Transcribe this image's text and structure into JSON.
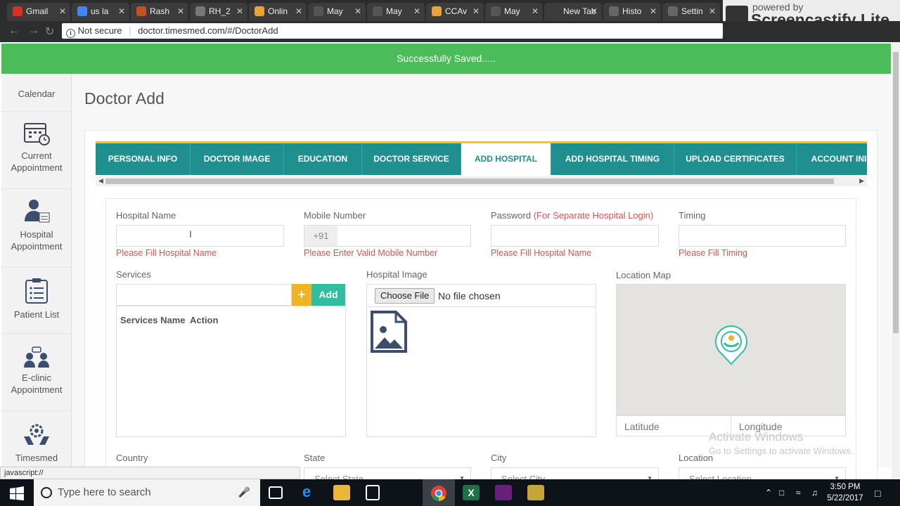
{
  "browser": {
    "tabs": [
      {
        "label": "Gmail",
        "icon_color": "#d93025"
      },
      {
        "label": "us la",
        "icon_color": "#4285f4"
      },
      {
        "label": "Rash",
        "icon_color": "#c8501e"
      },
      {
        "label": "RH_2",
        "icon_color": "#777777"
      },
      {
        "label": "Onlin",
        "icon_color": "#e8a33b"
      },
      {
        "label": "May",
        "icon_color": "#555555"
      },
      {
        "label": "May",
        "icon_color": "#555555"
      },
      {
        "label": "CCAv",
        "icon_color": "#e8a33b"
      },
      {
        "label": "May",
        "icon_color": "#555555"
      },
      {
        "label": "New Tab",
        "icon_color": "#3c3c3c"
      },
      {
        "label": "Histo",
        "icon_color": "#666666"
      },
      {
        "label": "Settin",
        "icon_color": "#666666"
      }
    ],
    "security_label": "Not secure",
    "url": "doctor.timesmed.com/#/DoctorAdd",
    "status_url": "javascript://",
    "overlay_top": "powered by",
    "overlay_brand": "Screencastify Lite"
  },
  "toast": {
    "message": "Successfully Saved....."
  },
  "sidebar": {
    "items": [
      {
        "label": "Calendar",
        "icon": "calendar-icon"
      },
      {
        "label": "Current Appointment",
        "icon": "calendar-clock-icon"
      },
      {
        "label": "Hospital Appointment",
        "icon": "doctor-icon"
      },
      {
        "label": "Patient List",
        "icon": "clipboard-list-icon"
      },
      {
        "label": "E-clinic Appointment",
        "icon": "users-chat-icon"
      },
      {
        "label": "Timesmed",
        "icon": "hands-gear-icon"
      }
    ]
  },
  "page": {
    "title": "Doctor Add",
    "tabs": [
      {
        "label": "PERSONAL INFO",
        "active": false
      },
      {
        "label": "DOCTOR IMAGE",
        "active": false
      },
      {
        "label": "EDUCATION",
        "active": false
      },
      {
        "label": "DOCTOR SERVICE",
        "active": false
      },
      {
        "label": "ADD HOSPITAL",
        "active": true
      },
      {
        "label": "ADD HOSPITAL TIMING",
        "active": false
      },
      {
        "label": "UPLOAD CERTIFICATES",
        "active": false
      },
      {
        "label": "ACCOUNT INI",
        "active": false
      }
    ]
  },
  "form": {
    "hospital_name": {
      "label": "Hospital Name",
      "value": "",
      "error": "Please Fill Hospital Name"
    },
    "mobile": {
      "label": "Mobile Number",
      "prefix": "+91",
      "value": "",
      "error": "Please Enter Valid Mobile Number"
    },
    "password": {
      "label": "Password",
      "note": "(For Separate Hospital Login)",
      "value": "",
      "error": "Please Fill Hospital Name"
    },
    "timing": {
      "label": "Timing",
      "value": "",
      "error": "Please Fill Timing"
    },
    "services": {
      "label": "Services",
      "add_label": "Add",
      "add_plus": "+",
      "col_name": "Services Name",
      "col_action": "Action"
    },
    "hospital_image": {
      "label": "Hospital Image",
      "button": "Choose File",
      "status": "No file chosen"
    },
    "location_map": {
      "label": "Location Map",
      "lat_placeholder": "Latitude",
      "lng_placeholder": "Longitude"
    },
    "country": {
      "label": "Country"
    },
    "state": {
      "label": "State",
      "placeholder": "Select State"
    },
    "city": {
      "label": "City",
      "placeholder": "Select City"
    },
    "location": {
      "label": "Location",
      "placeholder": "Select Location"
    }
  },
  "watermark": {
    "line1": "Activate Windows",
    "line2": "Go to Settings to activate Windows."
  },
  "taskbar": {
    "search_placeholder": "Type here to search",
    "time": "3:50 PM",
    "date": "5/22/2017"
  },
  "colors": {
    "teal": "#1f8f8f",
    "green": "#4cbb5a",
    "error": "#d9534f",
    "accent_yellow": "#f0c419"
  }
}
